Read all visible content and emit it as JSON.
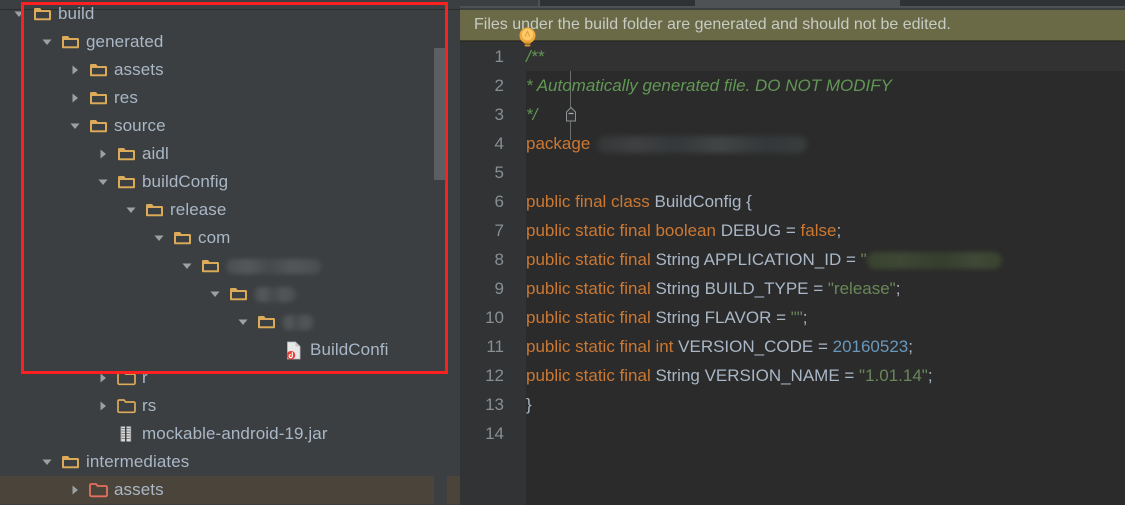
{
  "tree": {
    "scrollbar": {
      "name": "vertical-scrollbar"
    },
    "rows": [
      {
        "indent": 0,
        "twist": "down",
        "icon": "folder-solid",
        "label": "build",
        "selected": false,
        "redacted": false
      },
      {
        "indent": 1,
        "twist": "down",
        "icon": "folder-solid",
        "label": "generated",
        "selected": false,
        "redacted": false
      },
      {
        "indent": 2,
        "twist": "right",
        "icon": "folder-solid",
        "label": "assets",
        "selected": false,
        "redacted": false
      },
      {
        "indent": 2,
        "twist": "right",
        "icon": "folder-solid",
        "label": "res",
        "selected": false,
        "redacted": false
      },
      {
        "indent": 2,
        "twist": "down",
        "icon": "folder-solid",
        "label": "source",
        "selected": false,
        "redacted": false
      },
      {
        "indent": 3,
        "twist": "right",
        "icon": "folder-solid",
        "label": "aidl",
        "selected": false,
        "redacted": false
      },
      {
        "indent": 3,
        "twist": "down",
        "icon": "folder-solid",
        "label": "buildConfig",
        "selected": false,
        "redacted": false
      },
      {
        "indent": 4,
        "twist": "down",
        "icon": "folder-solid",
        "label": "release",
        "selected": false,
        "redacted": false
      },
      {
        "indent": 5,
        "twist": "down",
        "icon": "folder-solid",
        "label": "com",
        "selected": false,
        "redacted": false
      },
      {
        "indent": 6,
        "twist": "down",
        "icon": "folder-solid",
        "label": "",
        "selected": false,
        "redacted": true,
        "redactWidth": 95
      },
      {
        "indent": 7,
        "twist": "down",
        "icon": "folder-solid",
        "label": "",
        "selected": false,
        "redacted": true,
        "redactWidth": 42
      },
      {
        "indent": 8,
        "twist": "down",
        "icon": "folder-solid",
        "label": "",
        "selected": false,
        "redacted": true,
        "redactWidth": 32
      },
      {
        "indent": 9,
        "twist": "none",
        "icon": "java-file",
        "label": "BuildConfi",
        "selected": false,
        "redacted": false
      },
      {
        "indent": 3,
        "twist": "right",
        "icon": "folder-outline",
        "label": "r",
        "selected": false,
        "redacted": false
      },
      {
        "indent": 3,
        "twist": "right",
        "icon": "folder-outline",
        "label": "rs",
        "selected": false,
        "redacted": false
      },
      {
        "indent": 3,
        "twist": "none",
        "icon": "jar-file",
        "label": "mockable-android-19.jar",
        "selected": false,
        "redacted": false
      },
      {
        "indent": 1,
        "twist": "down",
        "icon": "folder-solid",
        "label": "intermediates",
        "selected": false,
        "redacted": false
      },
      {
        "indent": 2,
        "twist": "right",
        "icon": "folder-red",
        "label": "assets",
        "selected": true,
        "redacted": false
      }
    ]
  },
  "editor": {
    "notice": {
      "text": "Files under the build folder are generated and should not be edited.",
      "icon": "lightbulb-icon",
      "background": "#6a6a47"
    },
    "line_numbers": [
      "1",
      "2",
      "3",
      "4",
      "5",
      "6",
      "7",
      "8",
      "9",
      "10",
      "11",
      "12",
      "13",
      "14"
    ],
    "lines": [
      {
        "n": 1,
        "tokens": [
          {
            "t": "/**",
            "c": "cmt"
          }
        ]
      },
      {
        "n": 2,
        "tokens": [
          {
            "t": "  * Automatically generated file. DO NOT MODIFY",
            "c": "cmt"
          }
        ]
      },
      {
        "n": 3,
        "tokens": [
          {
            "t": "  */",
            "c": "cmt"
          }
        ]
      },
      {
        "n": 4,
        "tokens": [
          {
            "t": "package ",
            "c": "kw"
          },
          {
            "t": "",
            "c": "pkg-redact"
          }
        ]
      },
      {
        "n": 5,
        "tokens": []
      },
      {
        "n": 6,
        "tokens": [
          {
            "t": "public final class ",
            "c": "kw"
          },
          {
            "t": "BuildConfig {",
            "c": "cls"
          }
        ]
      },
      {
        "n": 7,
        "tokens": [
          {
            "t": "  public static final boolean ",
            "c": "kw"
          },
          {
            "t": "DEBUG = ",
            "c": "type"
          },
          {
            "t": "false",
            "c": "kw"
          },
          {
            "t": ";",
            "c": "type"
          }
        ]
      },
      {
        "n": 8,
        "tokens": [
          {
            "t": "  public static final ",
            "c": "kw"
          },
          {
            "t": "String APPLICATION_ID = ",
            "c": "type"
          },
          {
            "t": "\"",
            "c": "str"
          },
          {
            "t": "",
            "c": "str-redact"
          }
        ]
      },
      {
        "n": 9,
        "tokens": [
          {
            "t": "  public static final ",
            "c": "kw"
          },
          {
            "t": "String BUILD_TYPE = ",
            "c": "type"
          },
          {
            "t": "\"release\"",
            "c": "str"
          },
          {
            "t": ";",
            "c": "type"
          }
        ]
      },
      {
        "n": 10,
        "tokens": [
          {
            "t": "  public static final ",
            "c": "kw"
          },
          {
            "t": "String FLAVOR = ",
            "c": "type"
          },
          {
            "t": "\"\"",
            "c": "str"
          },
          {
            "t": ";",
            "c": "type"
          }
        ]
      },
      {
        "n": 11,
        "tokens": [
          {
            "t": "  public static final int ",
            "c": "kw"
          },
          {
            "t": "VERSION_CODE = ",
            "c": "type"
          },
          {
            "t": "20160523",
            "c": "num"
          },
          {
            "t": ";",
            "c": "type"
          }
        ]
      },
      {
        "n": 12,
        "tokens": [
          {
            "t": "  public static final ",
            "c": "kw"
          },
          {
            "t": "String VERSION_NAME = ",
            "c": "type"
          },
          {
            "t": "\"1.01.14\"",
            "c": "str"
          },
          {
            "t": ";",
            "c": "type"
          }
        ]
      },
      {
        "n": 13,
        "tokens": [
          {
            "t": "}",
            "c": "cls"
          }
        ]
      },
      {
        "n": 14,
        "tokens": []
      }
    ],
    "fold_markers": [
      {
        "line": 1
      },
      {
        "line": 3
      }
    ],
    "caret_line": 1
  },
  "annotation": {
    "name": "red-highlight-rectangle",
    "color": "#fd2020"
  },
  "colors": {
    "panel_bg": "#3c3f41",
    "editor_bg": "#2b2b2b",
    "gutter_bg": "#313335",
    "selection_bg": "#4b443a",
    "folder": "#d9a44b",
    "folder_red": "#e5705f",
    "text": "#a9b7c6",
    "keyword": "#cc7832",
    "string": "#6a8759",
    "number": "#6897bb",
    "comment": "#629755"
  }
}
